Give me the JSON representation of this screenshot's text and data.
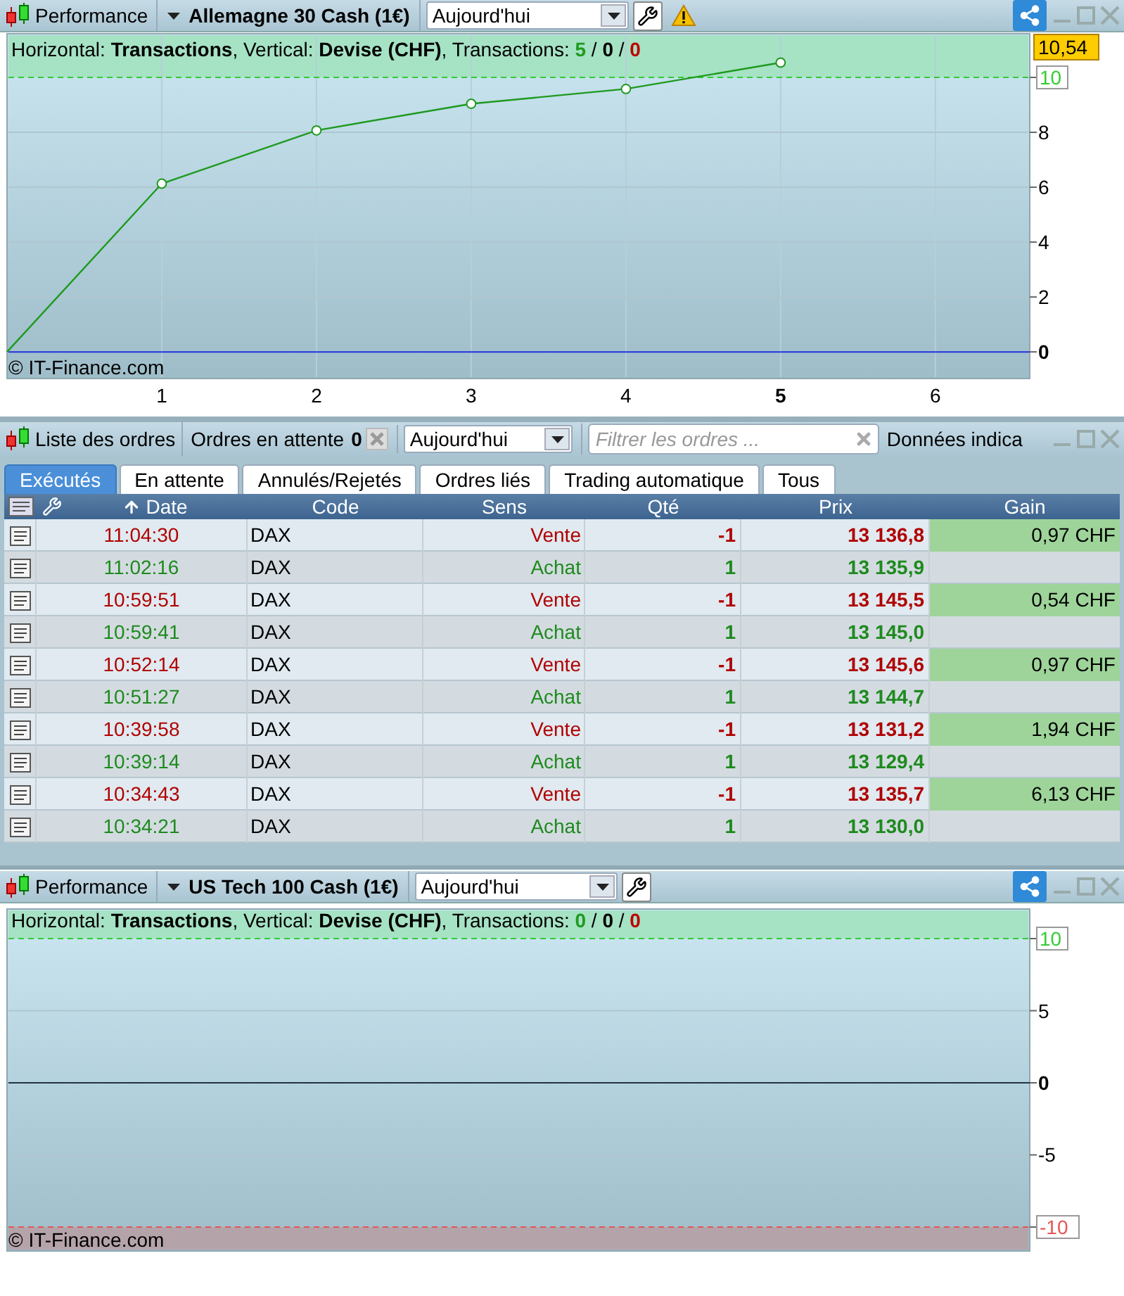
{
  "performance_top": {
    "title": "Performance",
    "instrument": "Allemagne 30 Cash (1€)",
    "period": "Aujourd'hui",
    "warning": true,
    "info": {
      "text": "Horizontal: **Transactions**, Vertical: **Devise (CHF)**, Transactions:",
      "separator": "/",
      "counts": [
        {
          "value": "5",
          "color": "#1e9a1e"
        },
        {
          "value": "0",
          "color": "#000000"
        },
        {
          "value": "0",
          "color": "#c00000"
        }
      ]
    },
    "copyright": "© IT-Finance.com",
    "chart_data": {
      "type": "line",
      "x": [
        0,
        1,
        2,
        3,
        4,
        5
      ],
      "series": [
        {
          "color": "#1e9a1e",
          "marker": "circle",
          "values": [
            0,
            6.13,
            8.07,
            9.04,
            9.58,
            10.54
          ]
        }
      ],
      "xlim": [
        0,
        6.61
      ],
      "ylim": [
        -0.97,
        11.59
      ],
      "grid": true,
      "xticks": [
        {
          "value": 1,
          "label": "1"
        },
        {
          "value": 2,
          "label": "2"
        },
        {
          "value": 3,
          "label": "3"
        },
        {
          "value": 4,
          "label": "4"
        },
        {
          "value": 5,
          "label": "5"
        },
        {
          "value": 6,
          "label": "6"
        }
      ],
      "yticks": [
        {
          "value": 0,
          "label": "0"
        },
        {
          "value": 2,
          "label": "2"
        },
        {
          "value": 4,
          "label": "4"
        },
        {
          "value": 6,
          "label": "6"
        },
        {
          "value": 8,
          "label": "8"
        },
        {
          "value": 10,
          "label": "10"
        }
      ],
      "bands": [
        {
          "axis": "y",
          "from": 10,
          "to": 11.59,
          "color": "#a6e2c4"
        }
      ],
      "ref_lines": [
        {
          "axis": "y",
          "value": 10,
          "color": "#33cc33"
        },
        {
          "axis": "y",
          "value": 0,
          "color": "#2233dd"
        }
      ],
      "annotations": [
        "10,54"
      ]
    }
  },
  "order_list": {
    "title": "Liste des ordres",
    "pending_label": "Ordres en attente",
    "pending_count": "0",
    "period": "Aujourd'hui",
    "filter_placeholder": "Filtrer les ordres ...",
    "data_label": "Données indica",
    "tabs": [
      {
        "label": "Exécutés",
        "selected": true
      },
      {
        "label": "En attente",
        "selected": false
      },
      {
        "label": "Annulés/Rejetés",
        "selected": false
      },
      {
        "label": "Ordres liés",
        "selected": false
      },
      {
        "label": "Trading automatique",
        "selected": false
      },
      {
        "label": "Tous",
        "selected": false
      }
    ],
    "columns": [
      "Date",
      "Code",
      "Sens",
      "Qté",
      "Prix",
      "Gain"
    ],
    "rows": [
      {
        "kind": "sell",
        "date": "11:04:30",
        "code": "DAX",
        "side": "Vente",
        "qty": "-1",
        "price": "13 136,8",
        "gain": "0,97 CHF"
      },
      {
        "kind": "buy",
        "date": "11:02:16",
        "code": "DAX",
        "side": "Achat",
        "qty": "1",
        "price": "13 135,9"
      },
      {
        "kind": "sell",
        "date": "10:59:51",
        "code": "DAX",
        "side": "Vente",
        "qty": "-1",
        "price": "13 145,5",
        "gain": "0,54 CHF"
      },
      {
        "kind": "buy",
        "date": "10:59:41",
        "code": "DAX",
        "side": "Achat",
        "qty": "1",
        "price": "13 145,0"
      },
      {
        "kind": "sell",
        "date": "10:52:14",
        "code": "DAX",
        "side": "Vente",
        "qty": "-1",
        "price": "13 145,6",
        "gain": "0,97 CHF"
      },
      {
        "kind": "buy",
        "date": "10:51:27",
        "code": "DAX",
        "side": "Achat",
        "qty": "1",
        "price": "13 144,7"
      },
      {
        "kind": "sell",
        "date": "10:39:58",
        "code": "DAX",
        "side": "Vente",
        "qty": "-1",
        "price": "13 131,2",
        "gain": "1,94 CHF"
      },
      {
        "kind": "buy",
        "date": "10:39:14",
        "code": "DAX",
        "side": "Achat",
        "qty": "1",
        "price": "13 129,4"
      },
      {
        "kind": "sell",
        "date": "10:34:43",
        "code": "DAX",
        "side": "Vente",
        "qty": "-1",
        "price": "13 135,7",
        "gain": "6,13 CHF"
      },
      {
        "kind": "buy",
        "date": "10:34:21",
        "code": "DAX",
        "side": "Achat",
        "qty": "1",
        "price": "13 130,0"
      }
    ]
  },
  "performance_bottom": {
    "title": "Performance",
    "instrument": "US Tech 100 Cash (1€)",
    "period": "Aujourd'hui",
    "info": {
      "text": "Horizontal: **Transactions**, Vertical: **Devise (CHF)**, Transactions:",
      "separator": "/",
      "counts": [
        {
          "value": "0",
          "color": "#1e9a1e"
        },
        {
          "value": "0",
          "color": "#000000"
        },
        {
          "value": "0",
          "color": "#c00000"
        }
      ]
    },
    "copyright": "© IT-Finance.com",
    "chart_data": {
      "type": "line",
      "categories": [
        null
      ],
      "series": [
        {
          "values": [
            null
          ]
        }
      ],
      "ylim": [
        -11.66,
        12.05
      ],
      "grid": true,
      "yticks": [
        {
          "value": -10,
          "label": "-10"
        },
        {
          "value": -5,
          "label": "-5"
        },
        {
          "value": 0,
          "label": "0"
        },
        {
          "value": 5,
          "label": "5"
        },
        {
          "value": 10,
          "label": "10"
        }
      ],
      "bands": [
        {
          "axis": "y",
          "from": 10,
          "to": 12.05,
          "color": "#a6e2c4"
        },
        {
          "axis": "y",
          "from": -11.66,
          "to": -10,
          "color": "#b5a3aa"
        }
      ],
      "ref_lines": [
        {
          "axis": "y",
          "value": 10,
          "color": "#33cc33"
        },
        {
          "axis": "y",
          "value": -10,
          "color": "#e55555"
        },
        {
          "axis": "y",
          "value": 0,
          "color": "#223344"
        }
      ]
    }
  }
}
